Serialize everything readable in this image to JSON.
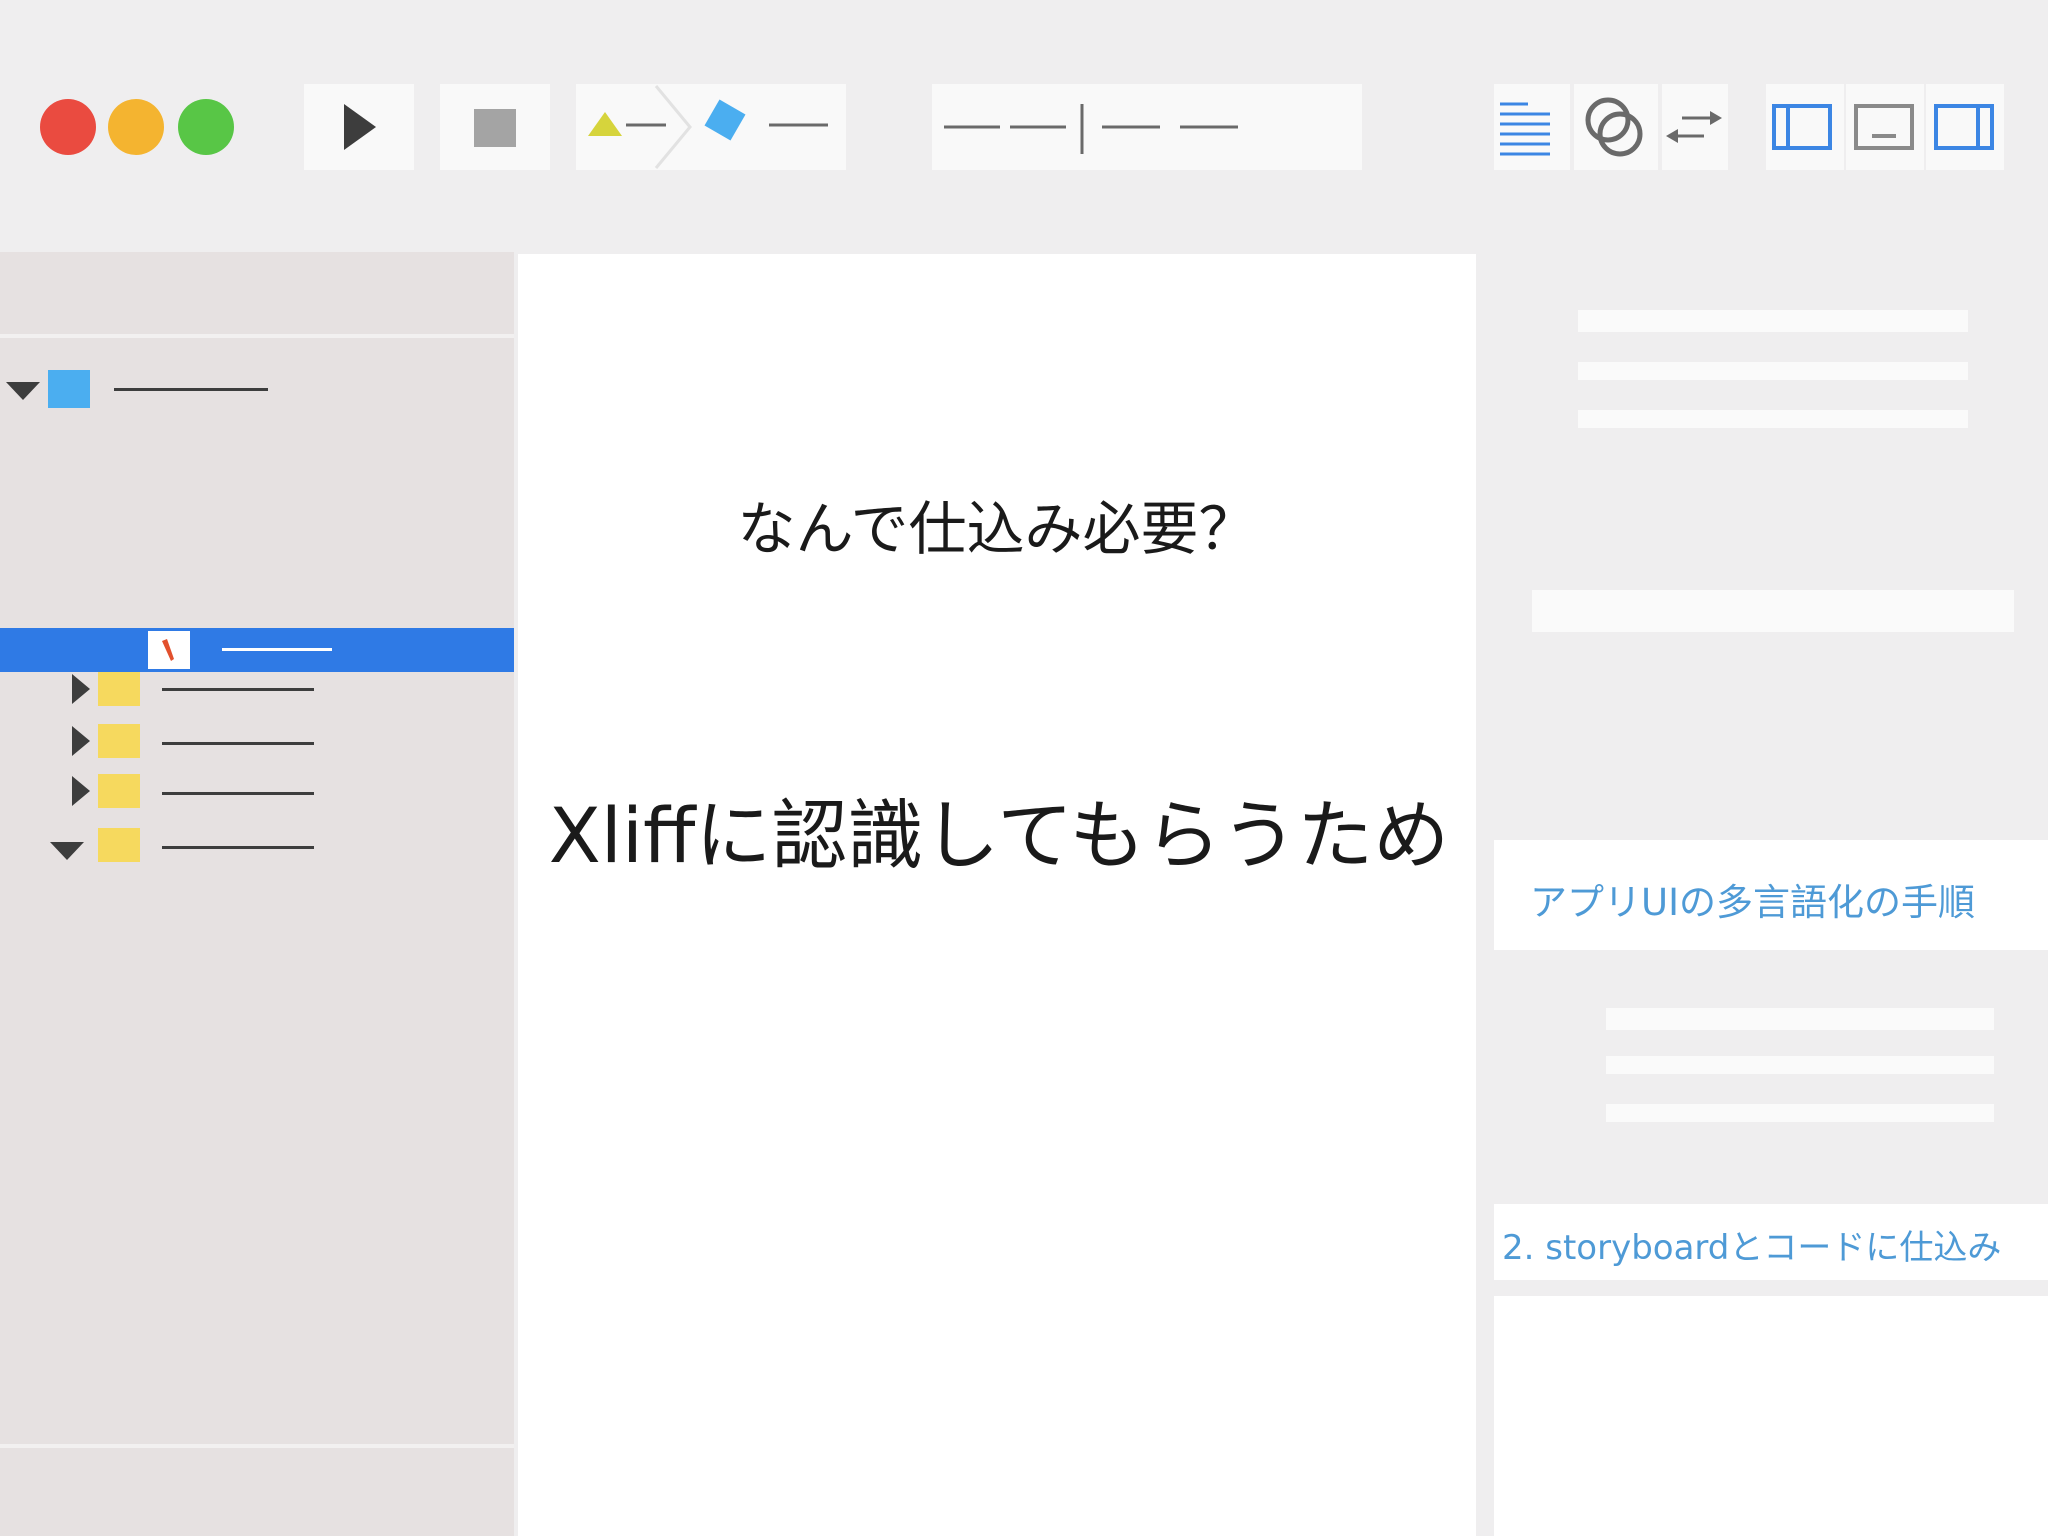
{
  "window": {
    "traffic_lights": {
      "close": "#ea4b40",
      "minimize": "#f4b430",
      "zoom": "#58c646"
    }
  },
  "toolbar": {
    "run_icon": "play-icon",
    "stop_icon": "stop-icon",
    "scheme_icons": [
      "triangle-icon",
      "diamond-icon"
    ],
    "colors": {
      "accent_blue": "#3c86e4",
      "scheme_yellow": "#d6d43c",
      "scheme_blue": "#4baef0"
    }
  },
  "sidebar": {
    "selection_color": "#2f7ae5",
    "file_icon": "swift-file-icon"
  },
  "editor": {
    "heading": "なんで仕込み必要？",
    "subheading": "Xliffに認識してもらうため"
  },
  "inspector": {
    "section_title": "アプリUIの多言語化の手順",
    "step_title": "2. storyboardとコードに仕込み",
    "text_color": "#4e9ad6"
  }
}
